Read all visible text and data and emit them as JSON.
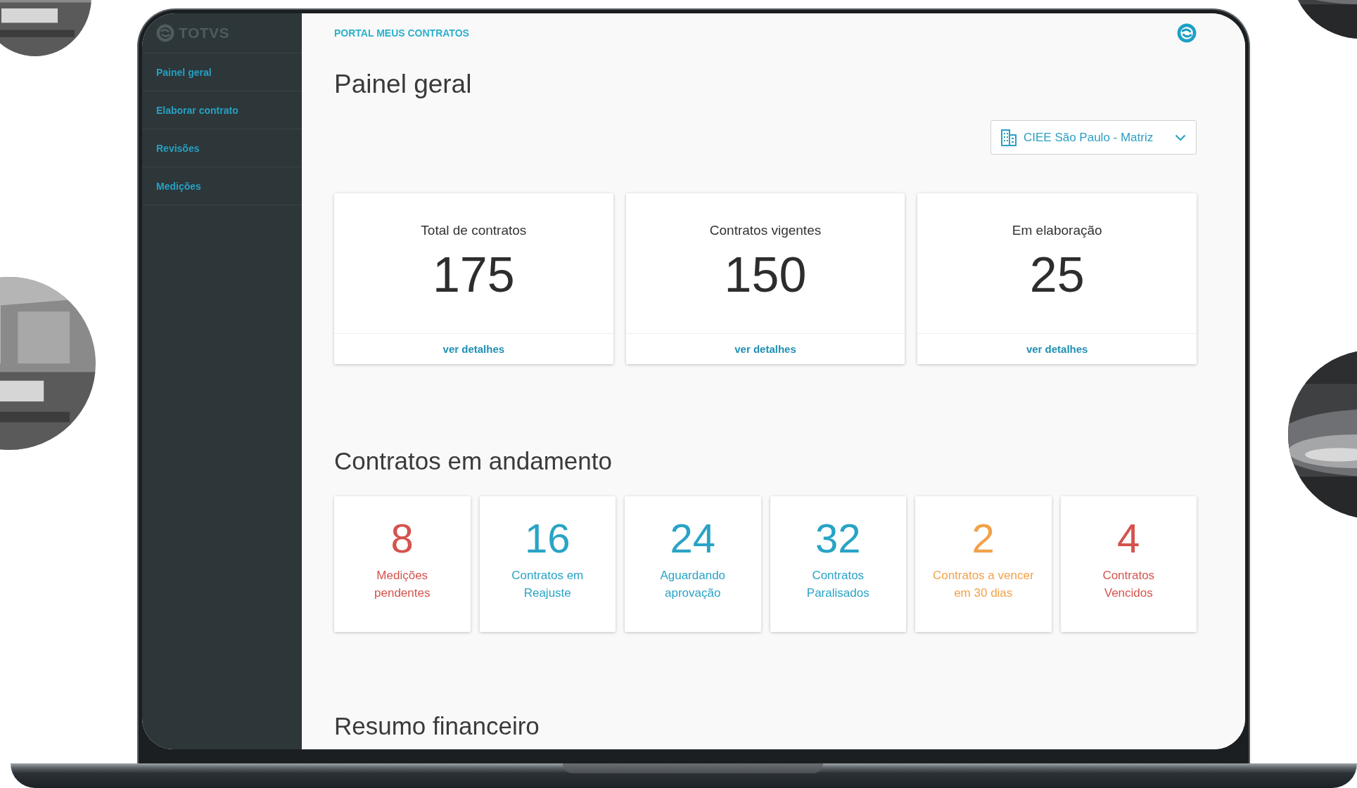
{
  "logo": {
    "text": "TOTVS"
  },
  "sidebar": {
    "items": [
      {
        "label": "Painel geral"
      },
      {
        "label": "Elaborar contrato"
      },
      {
        "label": "Revisões"
      },
      {
        "label": "Medições"
      }
    ]
  },
  "header": {
    "title": "PORTAL MEUS CONTRATOS"
  },
  "page_title": "Painel geral",
  "unit_select": {
    "value": "CIEE São Paulo - Matriz"
  },
  "summary_cards": [
    {
      "label": "Total de contratos",
      "value": "175",
      "link": "ver detalhes"
    },
    {
      "label": "Contratos vigentes",
      "value": "150",
      "link": "ver detalhes"
    },
    {
      "label": "Em elaboração",
      "value": "25",
      "link": "ver detalhes"
    }
  ],
  "in_progress": {
    "title": "Contratos em andamento",
    "cards": [
      {
        "value": "8",
        "label": "Medições\npendentes",
        "color": "#d4534d"
      },
      {
        "value": "16",
        "label": "Contratos em\nReajuste",
        "color": "#29a3c6"
      },
      {
        "value": "24",
        "label": "Aguardando\naprovação",
        "color": "#29a3c6"
      },
      {
        "value": "32",
        "label": "Contratos\nParalisados",
        "color": "#29a3c6"
      },
      {
        "value": "2",
        "label": "Contratos a vencer\nem 30 dias",
        "color": "#f2a24a"
      },
      {
        "value": "4",
        "label": "Contratos\nVencidos",
        "color": "#d4534d"
      }
    ]
  },
  "financial": {
    "title": "Resumo financeiro"
  }
}
